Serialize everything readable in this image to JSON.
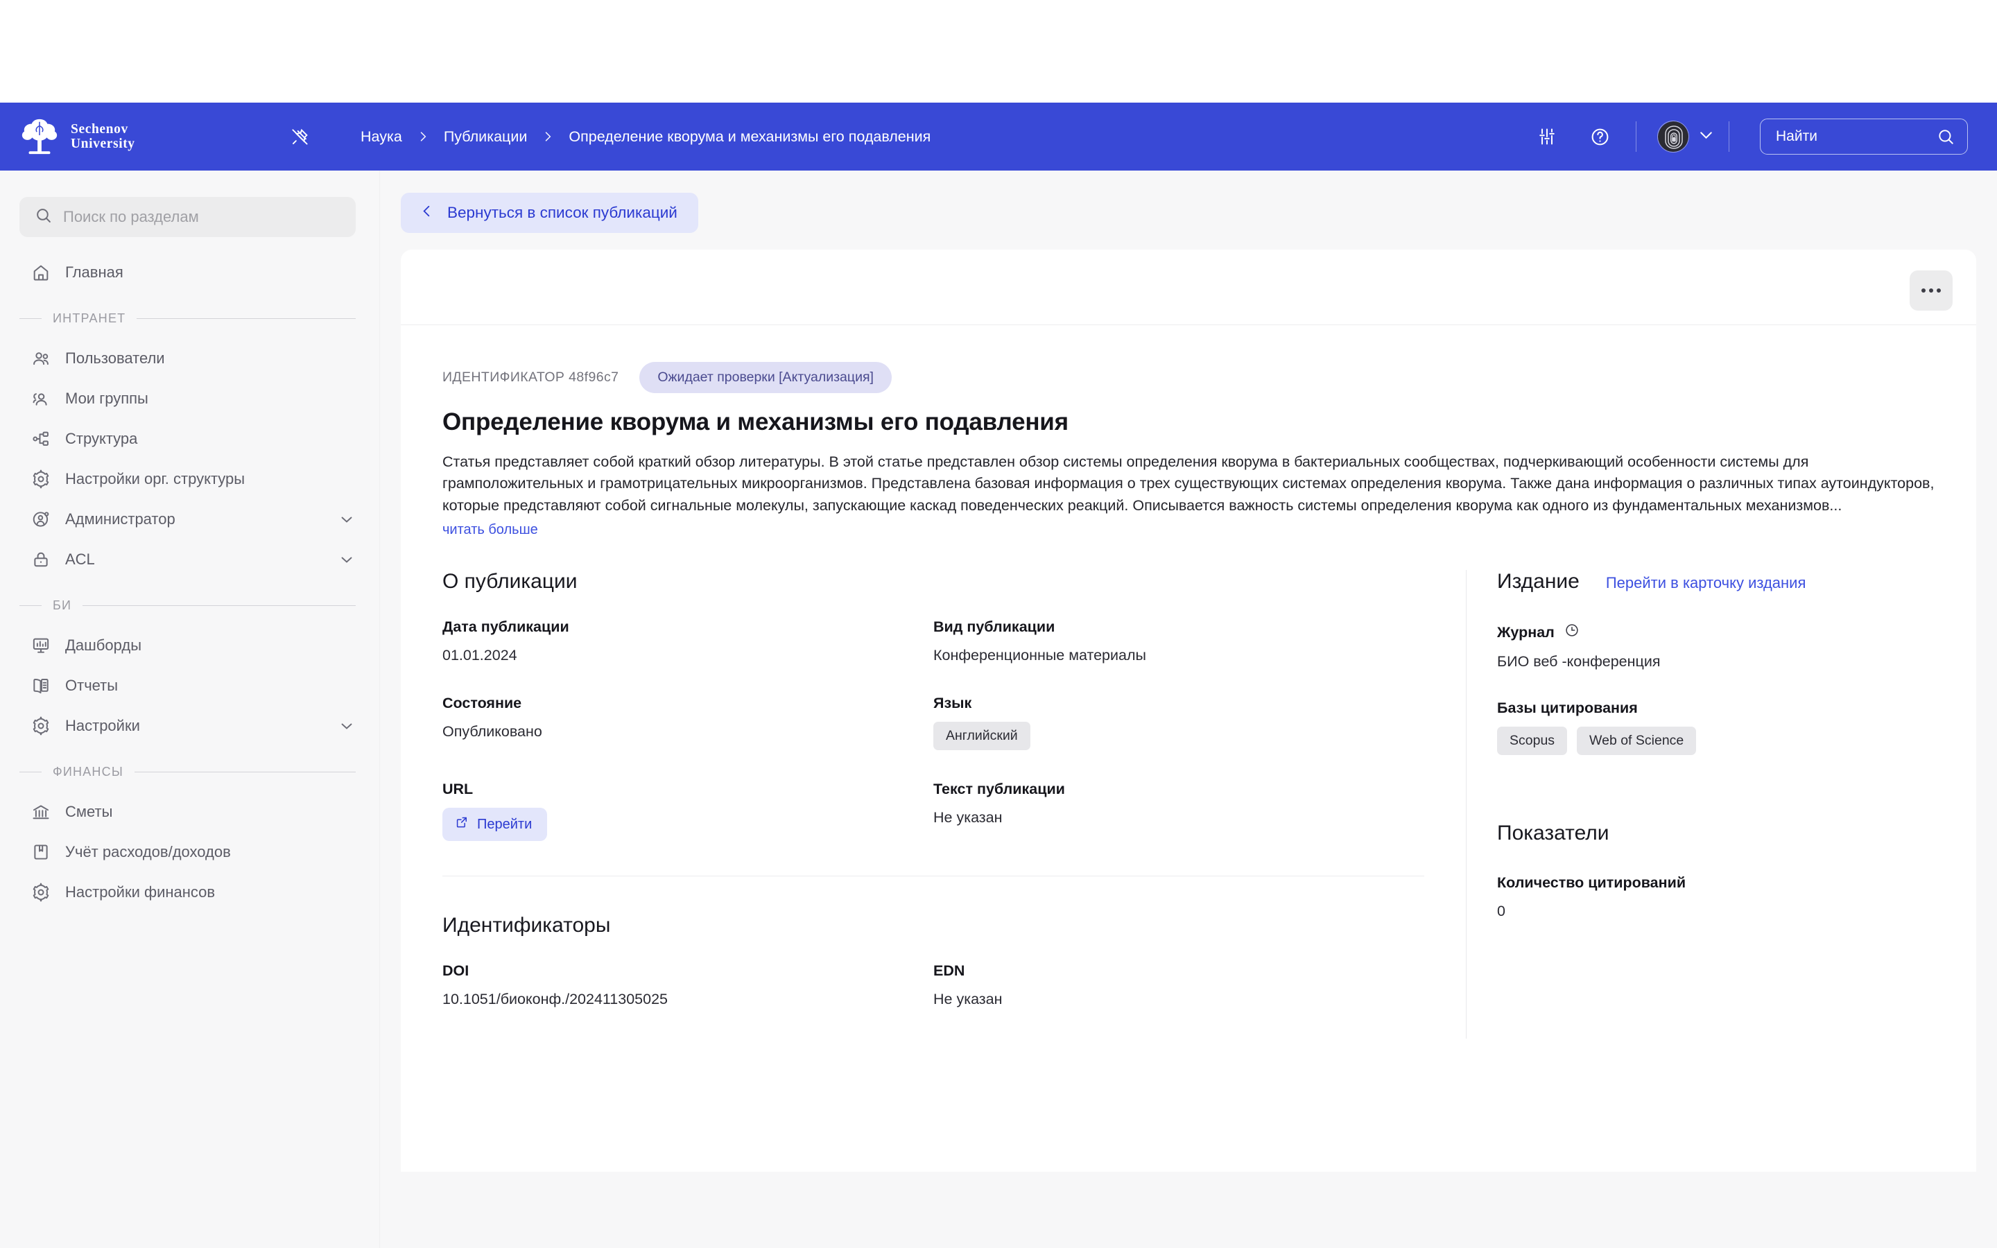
{
  "brand": {
    "line1": "Sechenov",
    "line2": "University",
    "logo_icon": "tree-logo-icon"
  },
  "header": {
    "pin_icon": "pin-off-icon",
    "breadcrumb": [
      {
        "label": "Наука"
      },
      {
        "label": "Публикации"
      },
      {
        "label": "Определение кворума и механизмы его подавления"
      }
    ],
    "separator_icon": "chevron-right-icon",
    "settings_icon": "sliders-icon",
    "help_icon": "question-circle-icon",
    "avatar_icon": "fingerprint-avatar-icon",
    "avatar_chevron_icon": "chevron-down-icon",
    "search": {
      "placeholder": "Найти",
      "icon": "search-icon"
    },
    "accent_color": "#3949d6"
  },
  "sidebar": {
    "search": {
      "placeholder": "Поиск по разделам",
      "icon": "search-icon"
    },
    "items": [
      {
        "type": "item",
        "label": "Главная",
        "icon": "home-icon",
        "chevron": false
      },
      {
        "type": "group",
        "label": "ИНТРАНЕТ"
      },
      {
        "type": "item",
        "label": "Пользователи",
        "icon": "users-icon",
        "chevron": false
      },
      {
        "type": "item",
        "label": "Мои группы",
        "icon": "user-group-icon",
        "chevron": false
      },
      {
        "type": "item",
        "label": "Структура",
        "icon": "sitemap-icon",
        "chevron": false
      },
      {
        "type": "item",
        "label": "Настройки орг. структуры",
        "icon": "gear-icon",
        "chevron": false
      },
      {
        "type": "item",
        "label": "Администратор",
        "icon": "user-gear-icon",
        "chevron": true
      },
      {
        "type": "item",
        "label": "ACL",
        "icon": "lock-icon",
        "chevron": true
      },
      {
        "type": "group",
        "label": "БИ"
      },
      {
        "type": "item",
        "label": "Дашборды",
        "icon": "dashboard-icon",
        "chevron": false
      },
      {
        "type": "item",
        "label": "Отчеты",
        "icon": "book-open-icon",
        "chevron": false
      },
      {
        "type": "item",
        "label": "Настройки",
        "icon": "gear-icon",
        "chevron": true
      },
      {
        "type": "group",
        "label": "ФИНАНСЫ"
      },
      {
        "type": "item",
        "label": "Сметы",
        "icon": "bank-icon",
        "chevron": false
      },
      {
        "type": "item",
        "label": "Учёт расходов/доходов",
        "icon": "ledger-book-icon",
        "chevron": false
      },
      {
        "type": "item",
        "label": "Настройки финансов",
        "icon": "gear-icon",
        "chevron": false
      }
    ]
  },
  "main": {
    "back_button": {
      "label": "Вернуться в список публикаций",
      "icon": "chevron-left-icon"
    },
    "kebab_menu": {
      "icon": "ellipsis-icon"
    },
    "identifier_label": "ИДЕНТИФИКАТОР 48f96c7",
    "status_badge": "Ожидает проверки [Актуализация]",
    "title": "Определение кворума и механизмы его подавления",
    "abstract": "Статья представляет собой краткий обзор литературы. В этой статье представлен обзор системы определения кворума в бактериальных сообществах, подчеркивающий особенности системы для грамположительных и грамотрицательных микроорганизмов. Представлена базовая информация о трех существующих системах определения кворума. Также дана информация о различных типах аутоиндукторов, которые представляют собой сигнальные молекулы, запускающие каскад поведенческих реакций. Описывается важность системы определения кворума как одного из фундаментальных механизмов...",
    "read_more": "читать больше",
    "about": {
      "section_title": "О публикации",
      "fields": [
        {
          "label": "Дата публикации",
          "value": "01.01.2024",
          "kind": "text"
        },
        {
          "label": "Вид публикации",
          "value": "Конференционные материалы",
          "kind": "text"
        },
        {
          "label": "Состояние",
          "value": "Опубликовано",
          "kind": "text"
        },
        {
          "label": "Язык",
          "value": "Английский",
          "kind": "chip"
        },
        {
          "label": "URL",
          "value": "Перейти",
          "kind": "link-button",
          "icon": "external-link-icon"
        },
        {
          "label": "Текст публикации",
          "value": "Не указан",
          "kind": "text"
        }
      ]
    },
    "identifiers": {
      "section_title": "Идентификаторы",
      "fields": [
        {
          "label": "DOI",
          "value": "10.1051/биоконф./202411305025"
        },
        {
          "label": "EDN",
          "value": "Не указан"
        }
      ]
    }
  },
  "right_panel": {
    "edition": {
      "title": "Издание",
      "link": "Перейти в карточку издания",
      "journal_label": "Журнал",
      "journal_icon": "clock-icon",
      "journal_value": "БИО веб -конференция",
      "databases_label": "Базы цитирования",
      "databases": [
        "Scopus",
        "Web of Science"
      ]
    },
    "metrics": {
      "title": "Показатели",
      "citations_label": "Количество цитирований",
      "citations_value": "0"
    }
  }
}
